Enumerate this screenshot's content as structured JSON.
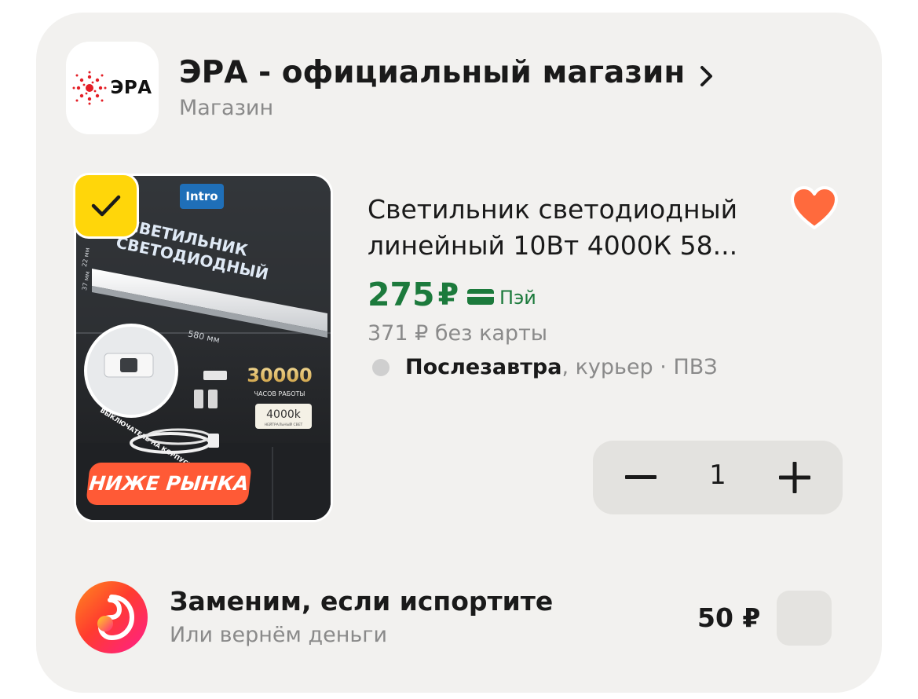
{
  "shop": {
    "logo_text": "ЭРА",
    "name": "ЭРА - официальный магазин",
    "subtitle": "Магазин"
  },
  "product": {
    "image_brand": "Intro",
    "image_line1": "СВЕТИЛЬНИК",
    "image_line2": "СВЕТОДИОДНЫЙ",
    "image_dim_length": "580 мм",
    "image_dim_width": "22 мм",
    "image_dim_height": "37 мм",
    "image_hours": "30000",
    "image_hours_label": "ЧАСОВ РАБОТЫ",
    "image_temp": "4000k",
    "image_temp_label": "НЕЙТРАЛЬНЫЙ СВЕТ",
    "image_switch_label": "ВЫКЛЮЧАТЕЛЬ НА КОРПУСЕ",
    "below_market_tag": "НИЖЕ РЫНКА",
    "title": "Светильник светодиодный линейный 10Вт 4000К 58...",
    "price": "275",
    "currency": "₽",
    "pay_label": "Пэй",
    "old_price": "371 ₽  без карты",
    "delivery_day": "Послезавтра",
    "delivery_rest": ", курьер · ПВЗ",
    "selected": true,
    "favorite": true
  },
  "quantity": {
    "value": "1"
  },
  "guarantee": {
    "title": "Заменим, если испортите",
    "subtitle": "Или вернём деньги",
    "price": "50 ₽",
    "checked": false
  },
  "colors": {
    "price_green": "#1c7a3c",
    "heart": "#ff6a3d",
    "check_badge": "#ffd60a",
    "tag": "#ff5a36"
  }
}
